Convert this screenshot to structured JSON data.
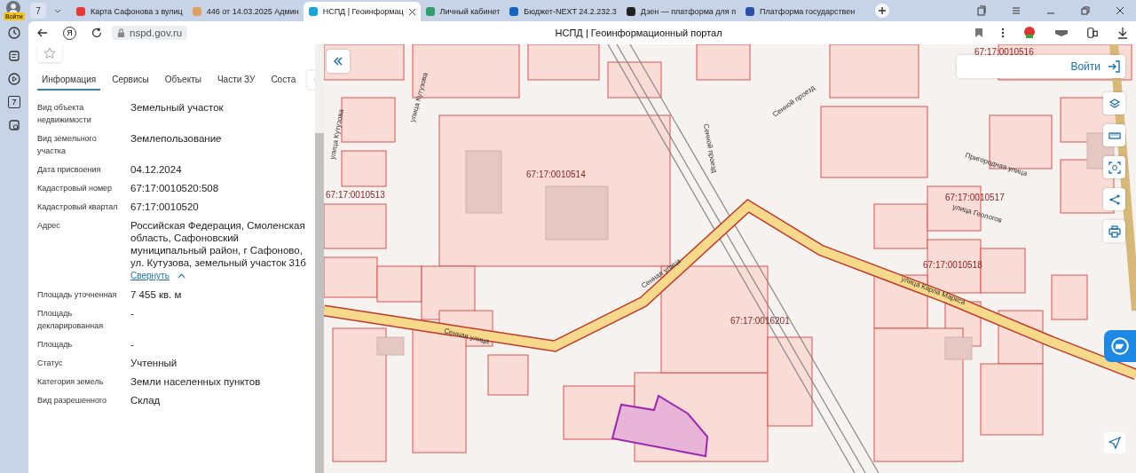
{
  "browser": {
    "account_label": "Войти",
    "tab_count": "7",
    "tabs": [
      {
        "title": "Карта Сафонова з вулиц",
        "selected": false
      },
      {
        "title": "446 от 14.03.2025 Админ",
        "selected": false
      },
      {
        "title": "НСПД | Геоинформац",
        "selected": true
      },
      {
        "title": "Личный кабинет",
        "selected": false
      },
      {
        "title": "Бюджет-NEXT 24.2.232.3",
        "selected": false
      },
      {
        "title": "Дзен — платформа для п",
        "selected": false
      },
      {
        "title": "Платформа государствен",
        "selected": false
      }
    ],
    "logo_letter": "Я",
    "address": "nspd.gov.ru",
    "page_title": "НСПД | Геоинформационный портал",
    "calendar_day": "7"
  },
  "panel": {
    "tabs": [
      {
        "label": "Информация",
        "selected": true
      },
      {
        "label": "Сервисы",
        "selected": false
      },
      {
        "label": "Объекты",
        "selected": false
      },
      {
        "label": "Части ЗУ",
        "selected": false
      },
      {
        "label": "Соста",
        "selected": false
      }
    ],
    "fields": [
      {
        "label": "Вид объекта недвижимости",
        "value": "Земельный участок"
      },
      {
        "label": "Вид земельного участка",
        "value": "Землепользование"
      },
      {
        "label": "Дата присвоения",
        "value": "04.12.2024"
      },
      {
        "label": "Кадастровый номер",
        "value": "67:17:0010520:508"
      },
      {
        "label": "Кадастровый квартал",
        "value": "67:17:0010520"
      },
      {
        "label": "Адрес",
        "value": "Российская Федерация, Смоленская область, Сафоновский муниципальный район, г Сафоново, ул. Кутузова, земельный участок 31б",
        "link": "Свернуть"
      },
      {
        "label": "Площадь уточненная",
        "value": "7 455 кв. м"
      },
      {
        "label": "Площадь декларированная",
        "value": "-"
      },
      {
        "label": "Площадь",
        "value": "-"
      },
      {
        "label": "Статус",
        "value": "Учтенный"
      },
      {
        "label": "Категория земель",
        "value": "Земли населенных пунктов"
      },
      {
        "label": "Вид разрешенного",
        "value": "Склад"
      }
    ]
  },
  "map": {
    "login": "Войти",
    "quarter_labels": [
      "67:17:0010514",
      "67:17:0010513",
      "67:17:0010516",
      "67:17:0010517",
      "67:17:0010518",
      "67:17:0016201"
    ],
    "street_labels": [
      "Сенная улица",
      "Сенная улица",
      "улица Кутузова",
      "улица Кутузова",
      "Сенной проезд",
      "Сенной проезд",
      "Пригородная улица",
      "улица Геологов",
      "улица Карла Маркса"
    ]
  }
}
